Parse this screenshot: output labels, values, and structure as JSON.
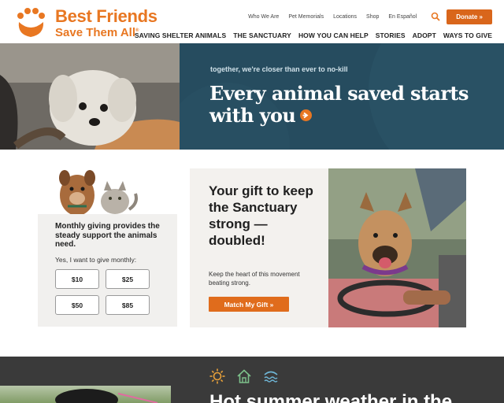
{
  "brand": {
    "line1": "Best Friends",
    "line2": "Save Them All",
    "trademark": "®",
    "accent_color": "#e87722"
  },
  "utility_nav": [
    "Who We Are",
    "Pet Memorials",
    "Locations",
    "Shop",
    "En Español"
  ],
  "search_icon": "search-icon",
  "donate_label": "Donate »",
  "main_nav": [
    "SAVING SHELTER ANIMALS",
    "THE SANCTUARY",
    "HOW YOU CAN HELP",
    "STORIES",
    "ADOPT",
    "WAYS TO GIVE"
  ],
  "hero": {
    "tagline": "together, we're closer than ever to no-kill",
    "headline": "Every animal saved starts with you",
    "arrow_icon": "arrow-right-circle-icon",
    "panel_color": "#264c5f"
  },
  "monthly": {
    "text": "Monthly giving provides the steady support the animals need.",
    "sub": "Yes, I want to give monthly:",
    "amounts": [
      "$10",
      "$25",
      "$50",
      "$85"
    ]
  },
  "gift": {
    "title": "Your gift to keep the Sanctuary strong — doubled!",
    "sub": "Keep the heart of this movement beating strong.",
    "cta": "Match My Gift »"
  },
  "bottom": {
    "icons": [
      "sun-icon",
      "house-icon",
      "heat-waves-icon"
    ],
    "headline": "Hot summer weather in the"
  }
}
